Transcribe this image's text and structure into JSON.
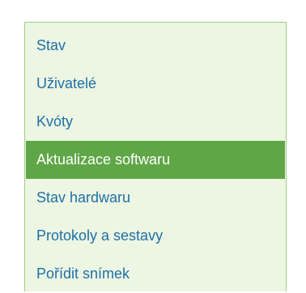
{
  "nav": {
    "items": [
      {
        "label": "Stav",
        "active": false
      },
      {
        "label": "Uživatelé",
        "active": false
      },
      {
        "label": "Kvóty",
        "active": false
      },
      {
        "label": "Aktualizace softwaru",
        "active": true
      },
      {
        "label": "Stav hardwaru",
        "active": false
      },
      {
        "label": "Protokoly a sestavy",
        "active": false
      },
      {
        "label": "Pořídit snímek",
        "active": false
      }
    ]
  },
  "colors": {
    "panel_background": "#ecf6e2",
    "panel_border": "#9ccf7e",
    "link_text": "#1f6fa8",
    "active_background": "#5fa646",
    "active_text": "#ffffff"
  }
}
